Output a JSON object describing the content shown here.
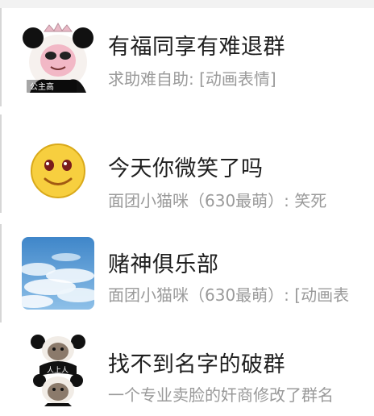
{
  "chats": [
    {
      "title": "有福同享有难退群",
      "preview": "求助难自助: [动画表情]",
      "avatar_icon": "panda-meme-avatar",
      "avatar_caption": "公主高"
    },
    {
      "title": "今天你微笑了吗",
      "preview": "面团小猫咪（630最萌）: 笑死",
      "avatar_icon": "smiley-face-avatar"
    },
    {
      "title": "赌神俱乐部",
      "preview": "面团小猫咪（630最萌）: [动画表",
      "avatar_icon": "clouds-sky-avatar"
    },
    {
      "title": "找不到名字的破群",
      "preview": "一个专业卖脸的奸商修改了群名",
      "avatar_icon": "panda-meme-duo-avatar",
      "avatar_caption": "人上人"
    }
  ],
  "colors": {
    "title": "#1f1f1f",
    "preview": "#9a9a9a",
    "background": "#ffffff"
  }
}
